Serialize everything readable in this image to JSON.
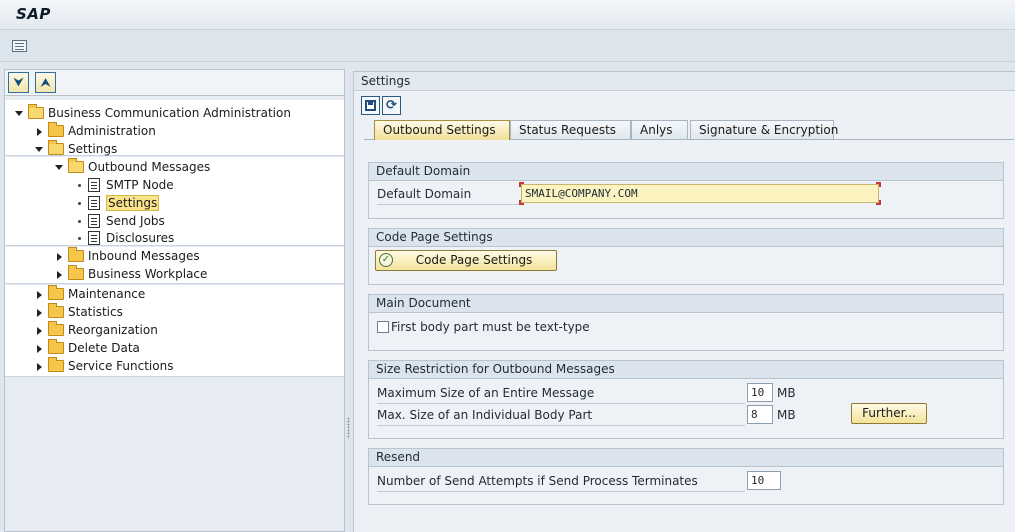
{
  "app": {
    "title": "SAP"
  },
  "toolbar": {
    "menu_icon": "menu-icon"
  },
  "tree": {
    "root": "Business Communication Administration",
    "administration": "Administration",
    "settings": "Settings",
    "outbound_messages": "Outbound Messages",
    "smtp_node": "SMTP Node",
    "settings_selected": "Settings",
    "send_jobs": "Send Jobs",
    "disclosures": "Disclosures",
    "inbound_messages": "Inbound Messages",
    "business_workplace": "Business Workplace",
    "maintenance": "Maintenance",
    "statistics": "Statistics",
    "reorganization": "Reorganization",
    "delete_data": "Delete Data",
    "service_functions": "Service Functions"
  },
  "panel": {
    "title": "Settings"
  },
  "tabs": [
    {
      "label": "Outbound Settings",
      "active": true
    },
    {
      "label": "Status Requests"
    },
    {
      "label": "Anlys"
    },
    {
      "label": "Signature & Encryption"
    }
  ],
  "default_domain": {
    "heading": "Default Domain",
    "label": "Default Domain",
    "value": "SMAIL@COMPANY.COM"
  },
  "code_page": {
    "heading": "Code Page Settings",
    "button": "Code Page Settings"
  },
  "main_document": {
    "heading": "Main Document",
    "checkbox_label": "First body part must be text-type",
    "checked": false
  },
  "size_restriction": {
    "heading": "Size Restriction for Outbound Messages",
    "max_message_label": "Maximum Size of an Entire Message",
    "max_message_value": "10",
    "max_message_unit": "MB",
    "max_part_label": "Max. Size of an Individual Body Part",
    "max_part_value": "8",
    "max_part_unit": "MB",
    "further_button": "Further..."
  },
  "resend": {
    "heading": "Resend",
    "attempts_label": "Number of Send Attempts if Send Process Terminates",
    "attempts_value": "10"
  }
}
